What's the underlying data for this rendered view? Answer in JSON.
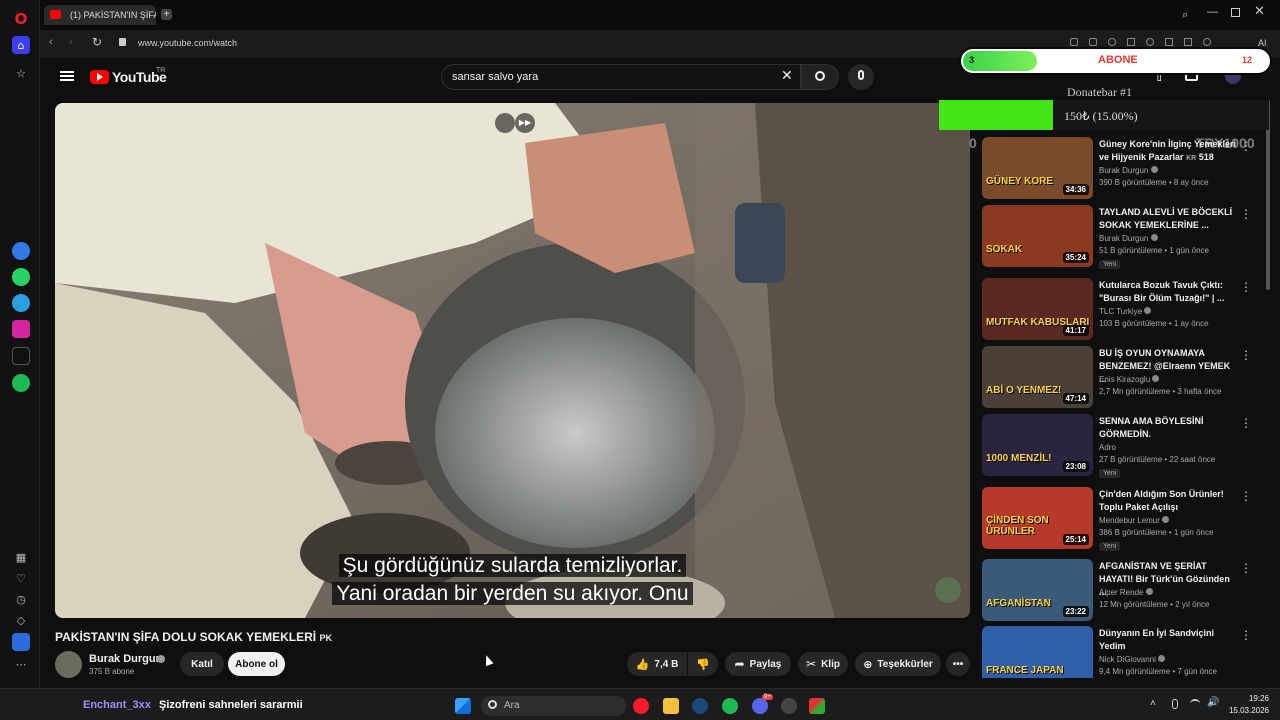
{
  "browser": {
    "tab_title": "(1) PAKİSTAN'IN ŞİFA D",
    "url": "www.youtube.com/watch",
    "ai_label": "AI"
  },
  "youtube": {
    "logo_text": "YouTube",
    "logo_region": "TR",
    "search_value": "sansar salvo yara",
    "notification_count": "1"
  },
  "video": {
    "subtitle_line1": "Şu gördüğünüz sularda temizliyorlar.",
    "subtitle_line2": "Yani oradan bir yerden su akıyor. Onu",
    "title": "PAKİSTAN'IN ŞİFA DOLU SOKAK YEMEKLERİ",
    "title_flag": "PK",
    "channel_name": "Burak Durgun",
    "subscribers": "375 B abone",
    "join_label": "Katıl",
    "subscribe_label": "Abone ol",
    "like_count": "7,4 B",
    "share_label": "Paylaş",
    "clip_label": "Klip",
    "thanks_label": "Teşekkürler"
  },
  "overlay": {
    "counter_left": "3",
    "counter_right": "12",
    "abone_label": "ABONE",
    "donate_title": "Donatebar #1",
    "donate_amount": "150₺ (15.00%)",
    "donate_progress": 0.15,
    "goal_left": "0",
    "goal_right": "TRY1000"
  },
  "recommendations": [
    {
      "title": "Güney Kore'nin İlginç Yemekleri ve Hijyenik Pazarlar",
      "flag": "KR",
      "ep": "518",
      "channel": "Burak Durgun",
      "verified": true,
      "meta": "390 B görüntüleme • 8 ay önce",
      "duration": "34:36",
      "badge": "",
      "thumb_text": "GÜNEY KORE",
      "thumb_color": "#7a4a2a"
    },
    {
      "title": "TAYLAND ALEVLİ VE BÖCEKLİ SOKAK YEMEKLERİNE ...",
      "channel": "Burak Durgun",
      "verified": true,
      "meta": "51 B görüntüleme • 1 gün önce",
      "duration": "35:24",
      "badge": "Yeni",
      "thumb_text": "SOKAK",
      "thumb_color": "#8a3b1f"
    },
    {
      "title": "Kutularca Bozuk Tavuk Çıktı: \"Burası Bir Ölüm Tuzağı!\" | ...",
      "channel": "TLC Turkiye",
      "verified": true,
      "meta": "103 B görüntüleme • 1 ay önce",
      "duration": "41:17",
      "badge": "",
      "thumb_text": "MUTFAK KABUSLARI",
      "thumb_color": "#5a2a22"
    },
    {
      "title": "BU İŞ OYUN OYNAMAYA BENZEMEZ! @Elraenn YEMEK ...",
      "channel": "Enis Kirazoglu",
      "verified": true,
      "meta": "2,7 Mn görüntüleme • 3 hafta önce",
      "duration": "47:14",
      "badge": "",
      "thumb_text": "ABİ O YENMEZ!",
      "thumb_color": "#4a4038"
    },
    {
      "title": "SENNA AMA BÖYLESİNİ GÖRMEDİN.",
      "channel": "Adro",
      "verified": false,
      "meta": "27 B görüntüleme • 22 saat önce",
      "duration": "23:08",
      "badge": "Yeni",
      "thumb_text": "1000 MENZİL!",
      "thumb_color": "#2a2440"
    },
    {
      "title": "Çin'den Aldığım Son Ürünler! Toplu Paket Açılışı",
      "channel": "Mendebur Lemur",
      "verified": true,
      "meta": "386 B görüntüleme • 1 gün önce",
      "duration": "25:14",
      "badge": "Yeni",
      "thumb_text": "ÇİNDEN SON ÜRÜNLER",
      "thumb_color": "#b53a2a"
    },
    {
      "title": "AFGANİSTAN VE ŞERİAT HAYATI! Bir Türk'ün Gözünden ...",
      "channel": "Alper Rende",
      "verified": true,
      "meta": "12 Mn görüntüleme • 2 yıl önce",
      "duration": "23:22",
      "badge": "",
      "thumb_text": "AFGANİSTAN",
      "thumb_color": "#3a5a7a"
    },
    {
      "title": "Dünyanın En İyi Sandviçini Yedim",
      "channel": "Nick DiGiovanni",
      "verified": true,
      "meta": "9,4 Mn görüntüleme • 7 gün önce",
      "duration": "",
      "badge": "",
      "thumb_text": "FRANCE   JAPAN",
      "thumb_color": "#2f5fa8"
    }
  ],
  "stream": {
    "chat_user": "Enchant_3xx",
    "chat_message": "Şizofreni sahneleri sararmii"
  },
  "taskbar": {
    "search_placeholder": "Ara",
    "time": "19:26",
    "date": "15.03.2026",
    "discord_badge": "9+"
  }
}
